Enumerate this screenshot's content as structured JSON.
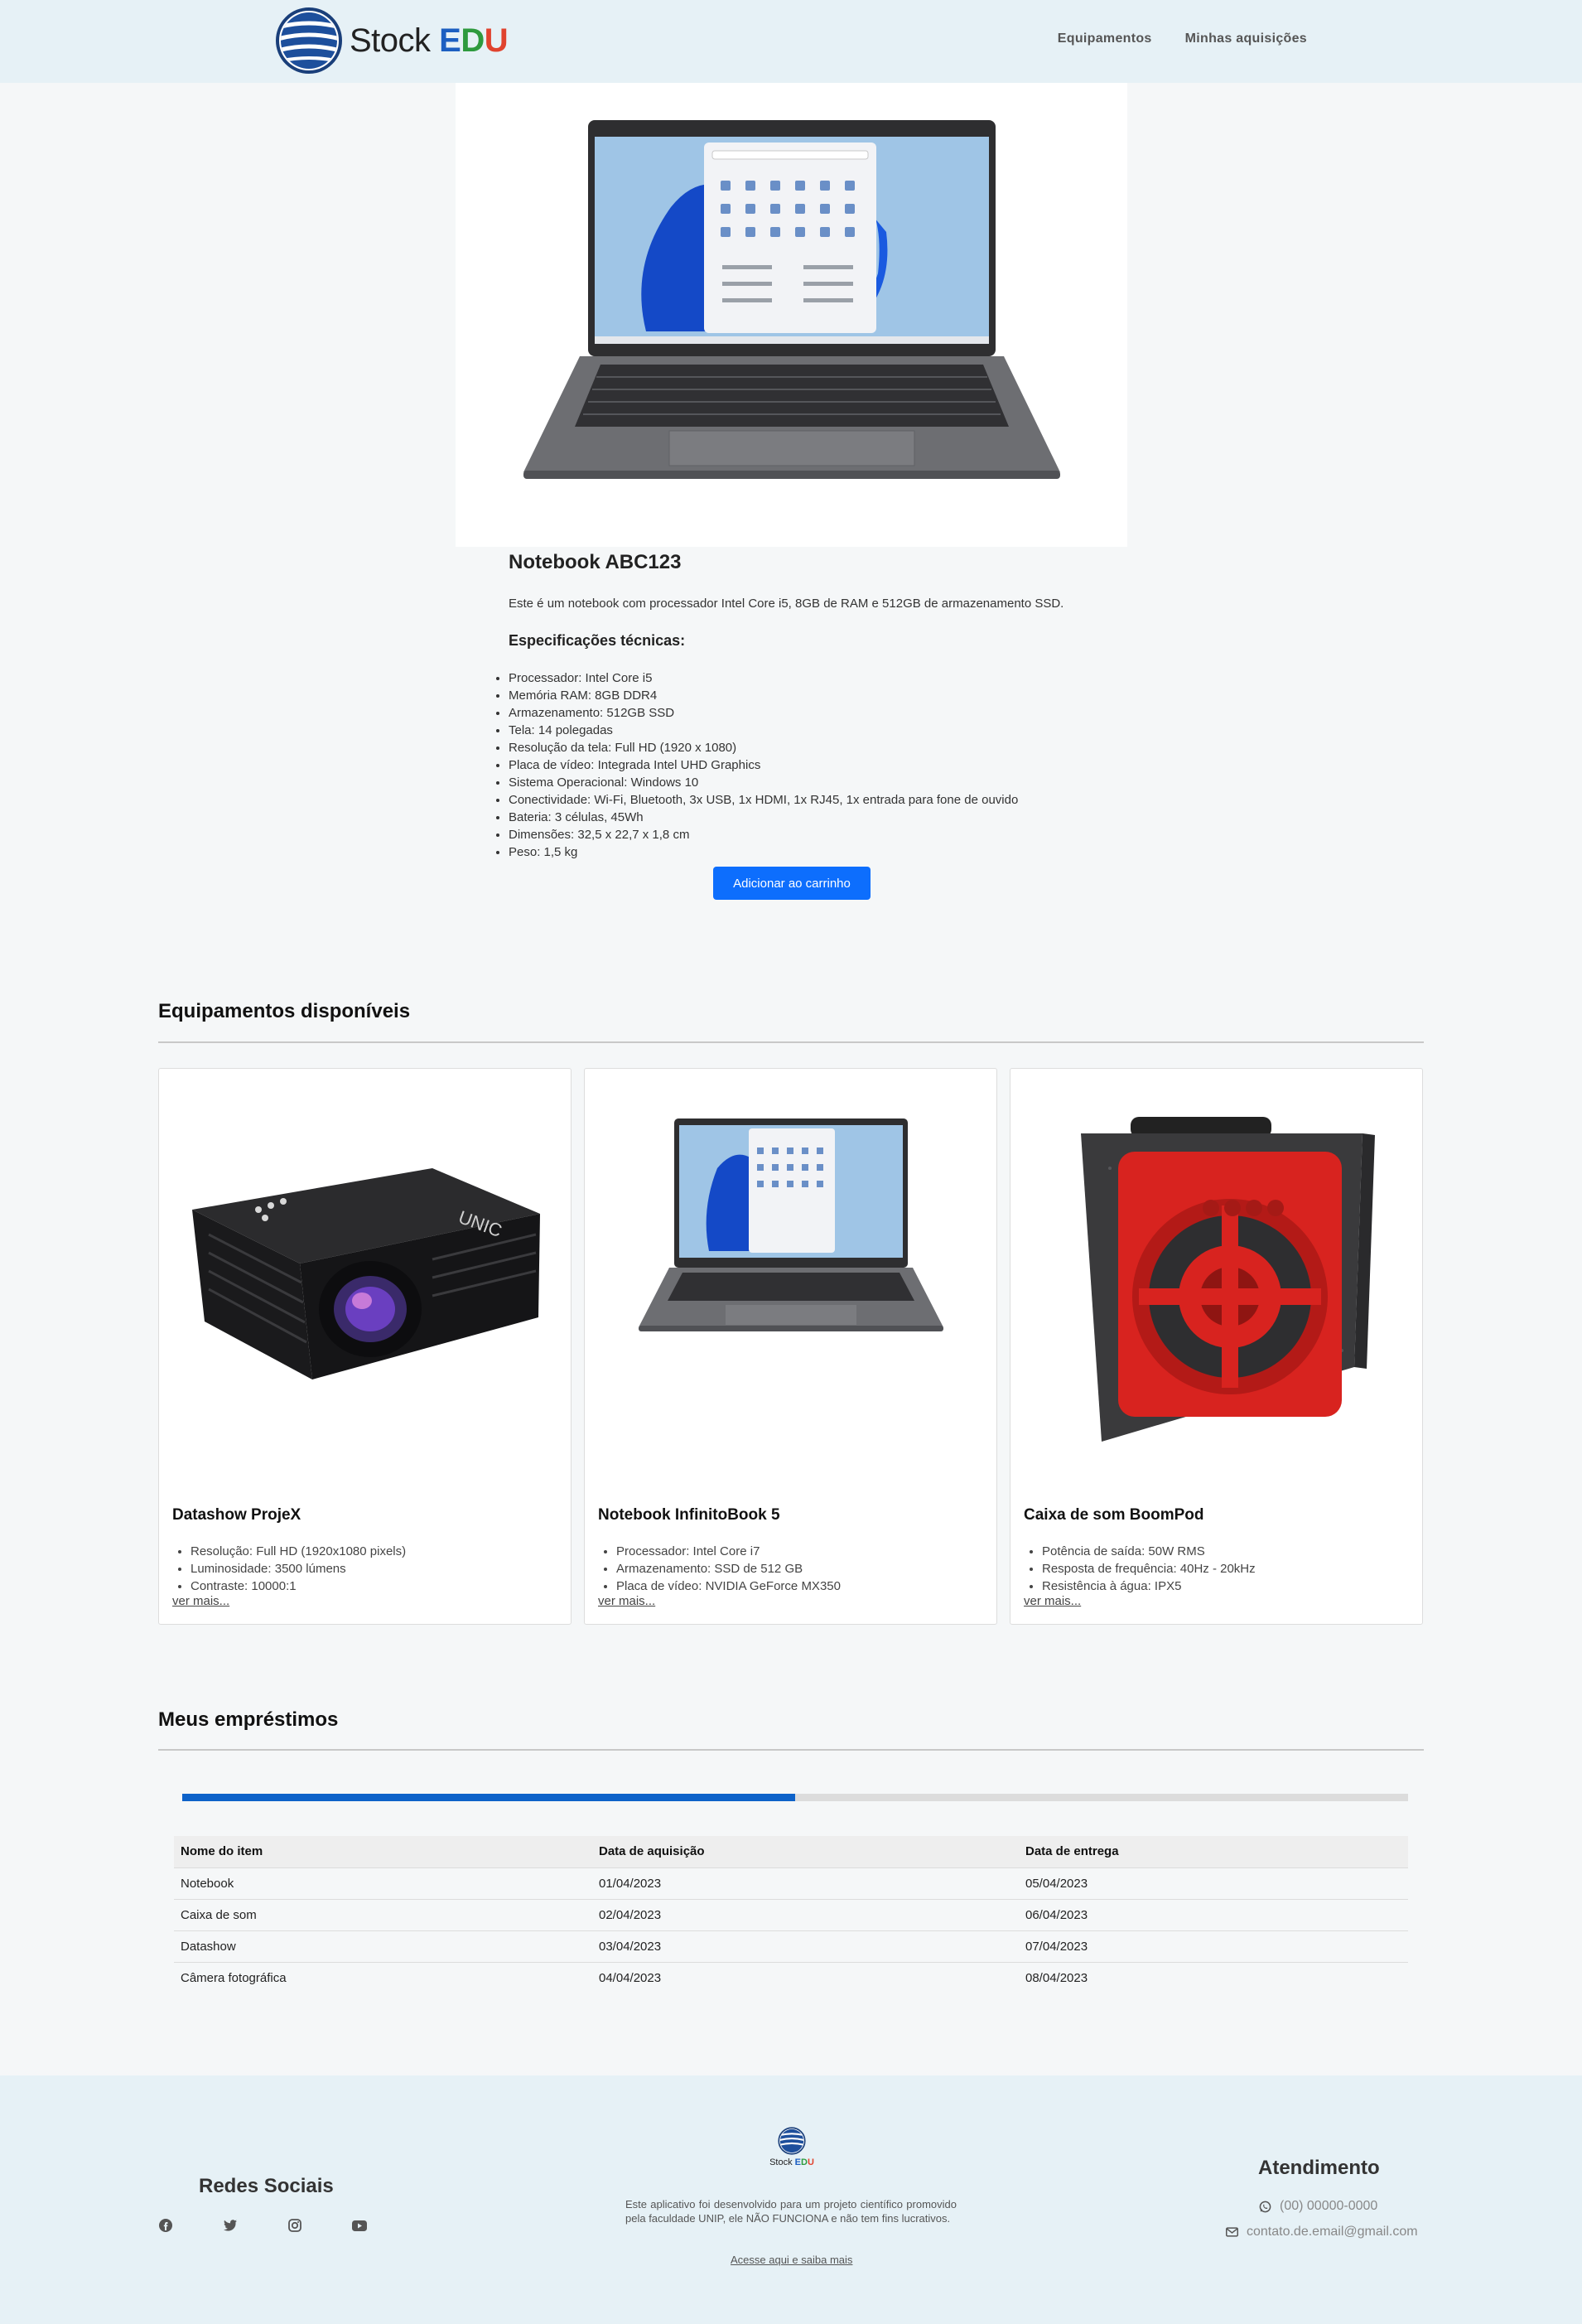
{
  "header": {
    "brand_main": "Stock ",
    "brand_e": "E",
    "brand_d": "D",
    "brand_u": "U",
    "nav": [
      "Equipamentos",
      "Minhas aquisições"
    ]
  },
  "product": {
    "title": "Notebook ABC123",
    "description": "Este é um notebook com processador Intel Core i5, 8GB de RAM e 512GB de armazenamento SSD.",
    "spec_title": "Especificações técnicas:",
    "specs": [
      "Processador: Intel Core i5",
      "Memória RAM: 8GB DDR4",
      "Armazenamento: 512GB SSD",
      "Tela: 14 polegadas",
      "Resolução da tela: Full HD (1920 x 1080)",
      "Placa de vídeo: Integrada Intel UHD Graphics",
      "Sistema Operacional: Windows 10",
      "Conectividade: Wi-Fi, Bluetooth, 3x USB, 1x HDMI, 1x RJ45, 1x entrada para fone de ouvido",
      "Bateria: 3 células, 45Wh",
      "Dimensões: 32,5 x 22,7 x 1,8 cm",
      "Peso: 1,5 kg"
    ],
    "button": "Adicionar ao carrinho"
  },
  "equipments": {
    "title": "Equipamentos disponíveis",
    "cards": [
      {
        "title": "Datashow ProjeX",
        "features": [
          "Resolução: Full HD (1920x1080 pixels)",
          "Luminosidade: 3500 lúmens",
          "Contraste: 10000:1"
        ],
        "more": "ver mais...",
        "image_icon": "projector-image"
      },
      {
        "title": "Notebook InfinitoBook 5",
        "features": [
          "Processador: Intel Core i7",
          "Armazenamento: SSD de 512 GB",
          "Placa de vídeo: NVIDIA GeForce MX350"
        ],
        "more": "ver mais...",
        "image_icon": "laptop-image"
      },
      {
        "title": "Caixa de som BoomPod",
        "features": [
          "Potência de saída: 50W RMS",
          "Resposta de frequência: 40Hz - 20kHz",
          "Resistência à água: IPX5"
        ],
        "more": "ver mais...",
        "image_icon": "speaker-image"
      }
    ]
  },
  "loans": {
    "title": "Meus empréstimos",
    "progress_fraction": 0.5,
    "columns": [
      "Nome do item",
      "Data de aquisição",
      "Data de entrega"
    ],
    "rows": [
      [
        "Notebook",
        "01/04/2023",
        "05/04/2023"
      ],
      [
        "Caixa de som",
        "02/04/2023",
        "06/04/2023"
      ],
      [
        "Datashow",
        "03/04/2023",
        "07/04/2023"
      ],
      [
        "Câmera fotográfica",
        "04/04/2023",
        "08/04/2023"
      ]
    ]
  },
  "footer": {
    "social_title": "Redes Sociais",
    "social_icons": [
      "facebook-icon",
      "twitter-icon",
      "instagram-icon",
      "youtube-icon"
    ],
    "logo_text_main": "Stock ",
    "logo_e": "E",
    "logo_d": "D",
    "logo_u": "U",
    "description": "Este aplicativo foi desenvolvido para um projeto científico promovido pela faculdade UNIP, ele NÃO FUNCIONA e não tem fins lucrativos.",
    "link": "Acesse aqui e saiba mais",
    "contact_title": "Atendimento",
    "phone": "(00) 00000-0000",
    "email": "contato.de.email@gmail.com"
  },
  "colors": {
    "header_bg": "#e6f1f6",
    "primary_button": "#0d6efd",
    "progress_fill": "#0d62c9",
    "speaker_red": "#d8231f"
  }
}
